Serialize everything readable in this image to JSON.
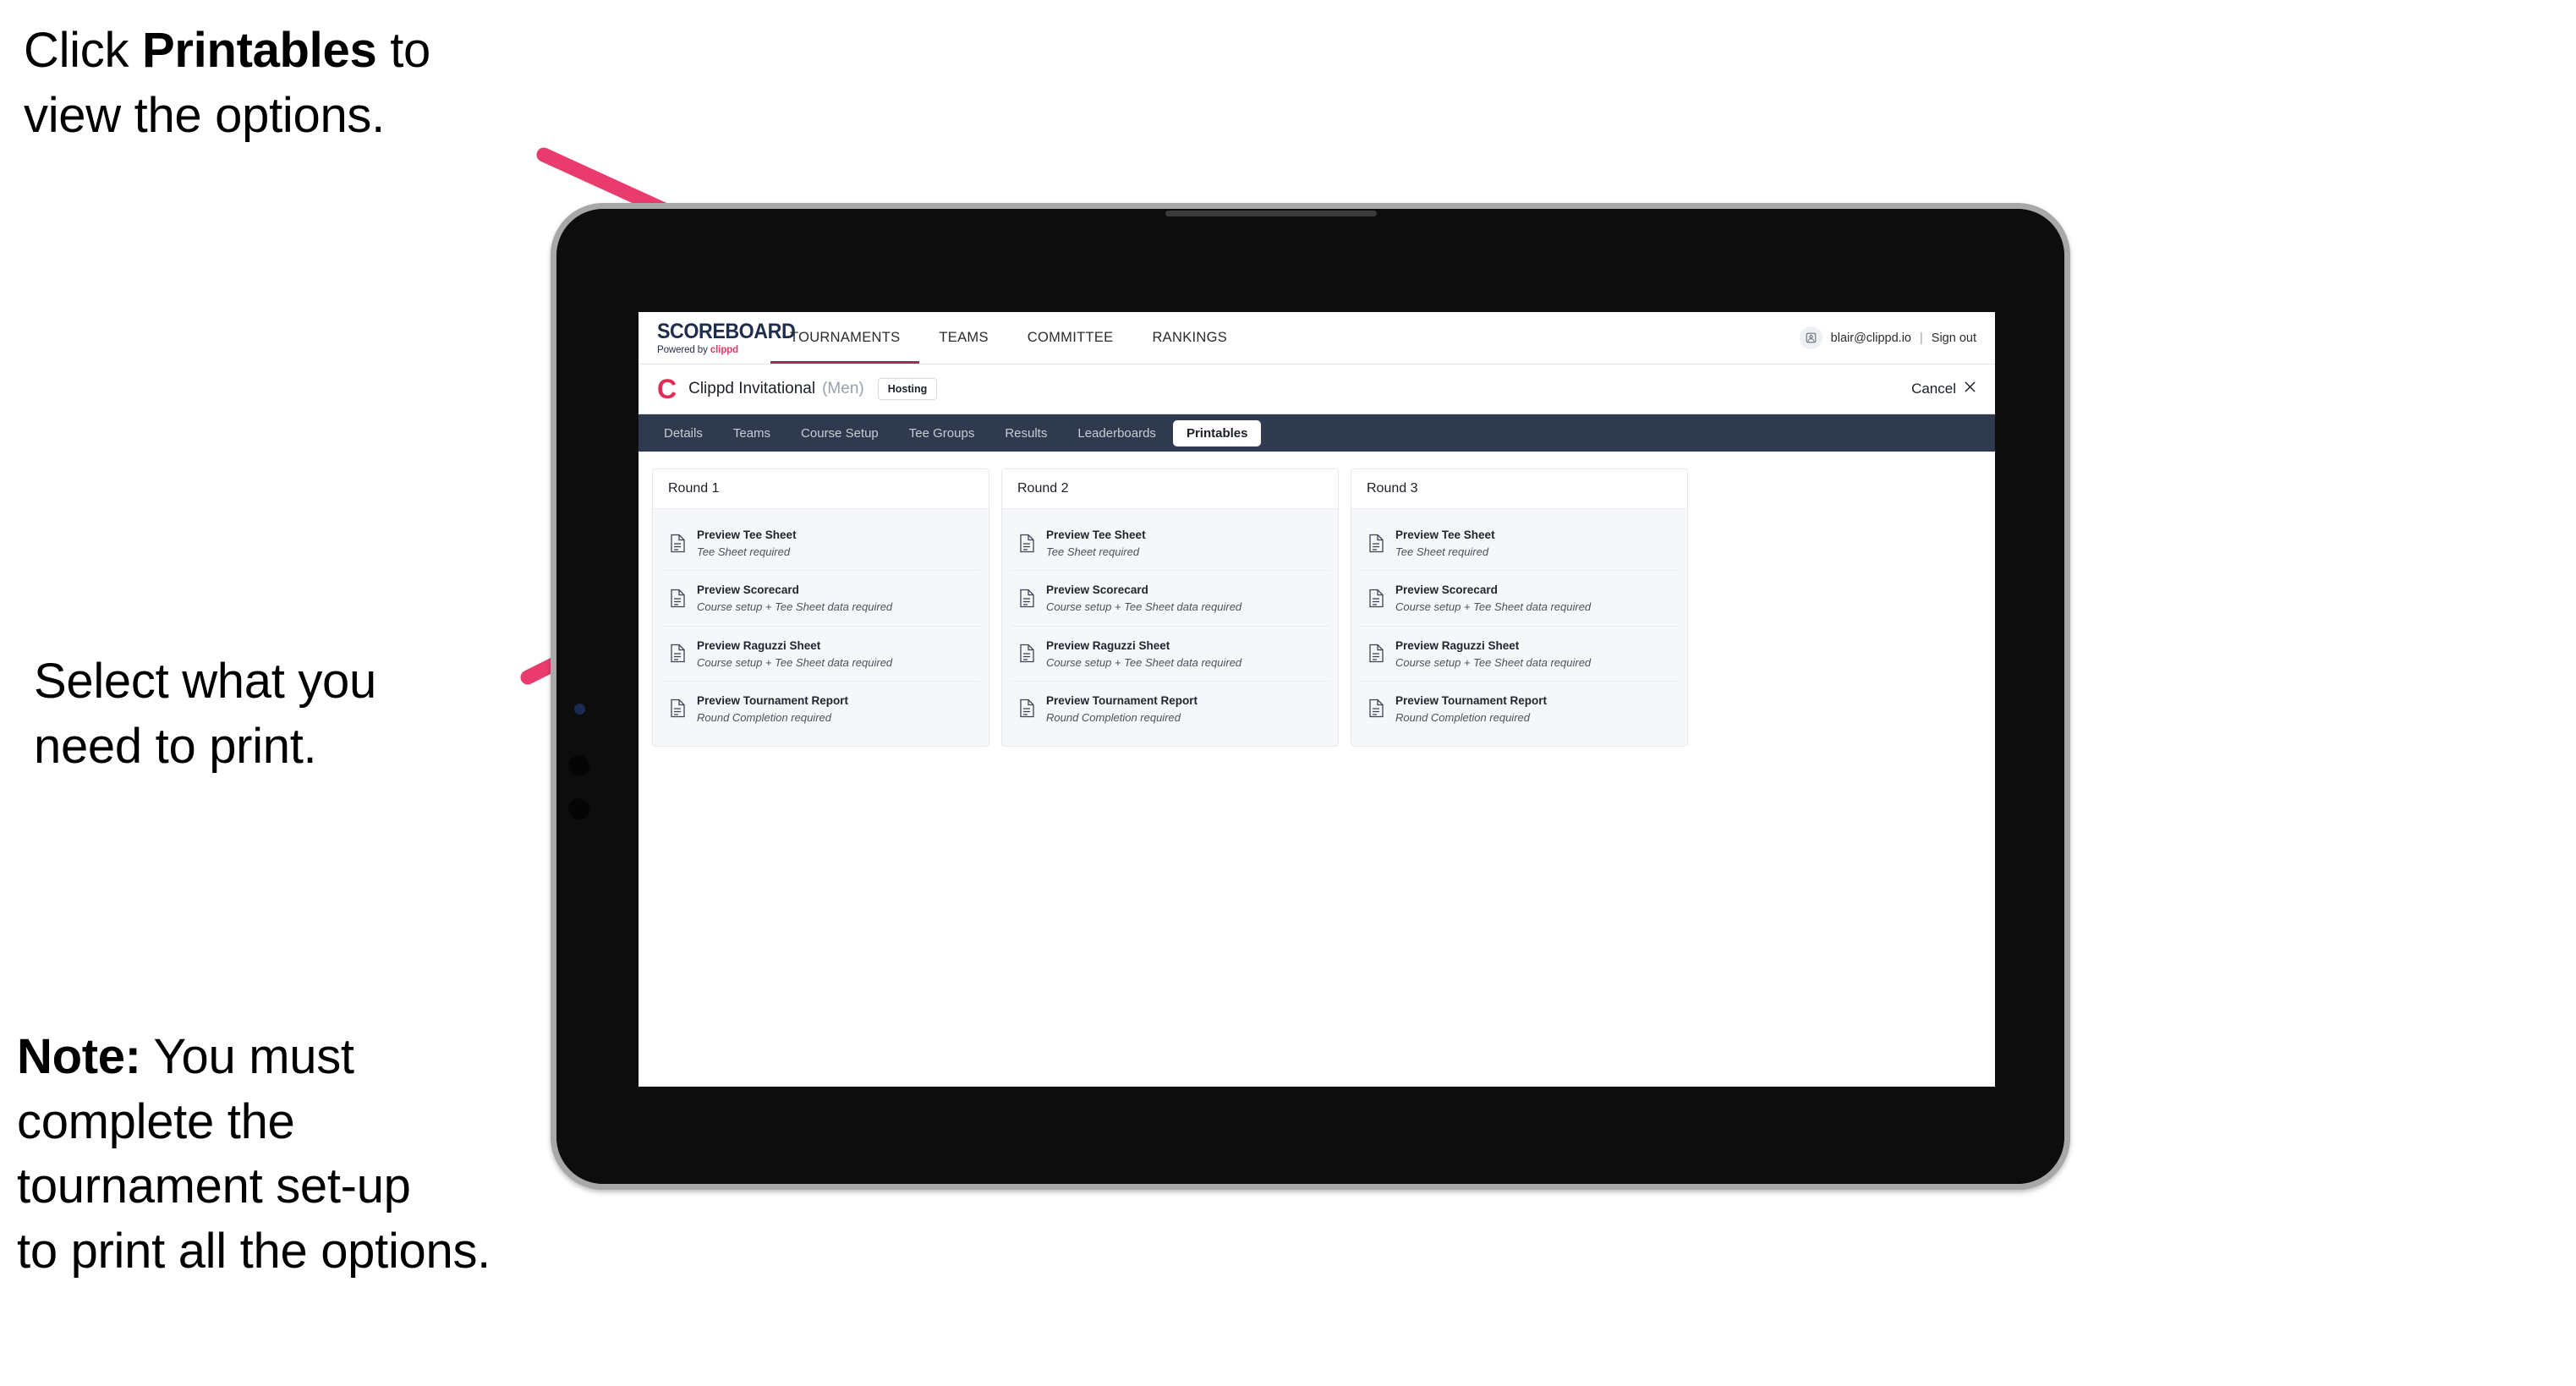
{
  "annotations": {
    "click_printables": {
      "prefix": "Click ",
      "bold": "Printables",
      "suffix": " to\nview the options."
    },
    "select_print": "Select what you\n need to print.",
    "note": {
      "bold": "Note:",
      "text": " You must\ncomplete the\ntournament set-up\nto print all the options."
    }
  },
  "colors": {
    "arrow_pink": "#ea3b6e",
    "brand_navy": "#1f2d4d",
    "clippd_pink": "#e8386a",
    "tabbar_navy": "#2f3a4f",
    "active_underline": "#a02d4e"
  },
  "app": {
    "brand": {
      "title": "SCOREBOARD",
      "powered_prefix": "Powered by ",
      "powered_brand": "clippd"
    },
    "topnav": {
      "items": [
        {
          "label": "TOURNAMENTS",
          "active": true
        },
        {
          "label": "TEAMS",
          "active": false
        },
        {
          "label": "COMMITTEE",
          "active": false
        },
        {
          "label": "RANKINGS",
          "active": false
        }
      ],
      "avatar_icon": "user-avatar-icon",
      "user_email": "blair@clippd.io",
      "separator": "|",
      "sign_out": "Sign out"
    },
    "subheader": {
      "logo_mark": "C",
      "tournament_name": "Clippd Invitational",
      "gender": "(Men)",
      "badge": "Hosting",
      "cancel_label": "Cancel",
      "cancel_icon": "close-icon"
    },
    "tabs": [
      {
        "label": "Details",
        "active": false
      },
      {
        "label": "Teams",
        "active": false
      },
      {
        "label": "Course Setup",
        "active": false
      },
      {
        "label": "Tee Groups",
        "active": false
      },
      {
        "label": "Results",
        "active": false
      },
      {
        "label": "Leaderboards",
        "active": false
      },
      {
        "label": "Printables",
        "active": true
      }
    ],
    "rounds": [
      {
        "title": "Round 1",
        "items": [
          {
            "title": "Preview Tee Sheet",
            "sub": "Tee Sheet required",
            "icon": "document-icon"
          },
          {
            "title": "Preview Scorecard",
            "sub": "Course setup + Tee Sheet data required",
            "icon": "document-icon"
          },
          {
            "title": "Preview Raguzzi Sheet",
            "sub": "Course setup + Tee Sheet data required",
            "icon": "document-icon"
          },
          {
            "title": "Preview Tournament Report",
            "sub": "Round Completion required",
            "icon": "document-icon"
          }
        ]
      },
      {
        "title": "Round 2",
        "items": [
          {
            "title": "Preview Tee Sheet",
            "sub": "Tee Sheet required",
            "icon": "document-icon"
          },
          {
            "title": "Preview Scorecard",
            "sub": "Course setup + Tee Sheet data required",
            "icon": "document-icon"
          },
          {
            "title": "Preview Raguzzi Sheet",
            "sub": "Course setup + Tee Sheet data required",
            "icon": "document-icon"
          },
          {
            "title": "Preview Tournament Report",
            "sub": "Round Completion required",
            "icon": "document-icon"
          }
        ]
      },
      {
        "title": "Round 3",
        "items": [
          {
            "title": "Preview Tee Sheet",
            "sub": "Tee Sheet required",
            "icon": "document-icon"
          },
          {
            "title": "Preview Scorecard",
            "sub": "Course setup + Tee Sheet data required",
            "icon": "document-icon"
          },
          {
            "title": "Preview Raguzzi Sheet",
            "sub": "Course setup + Tee Sheet data required",
            "icon": "document-icon"
          },
          {
            "title": "Preview Tournament Report",
            "sub": "Round Completion required",
            "icon": "document-icon"
          }
        ]
      }
    ]
  }
}
